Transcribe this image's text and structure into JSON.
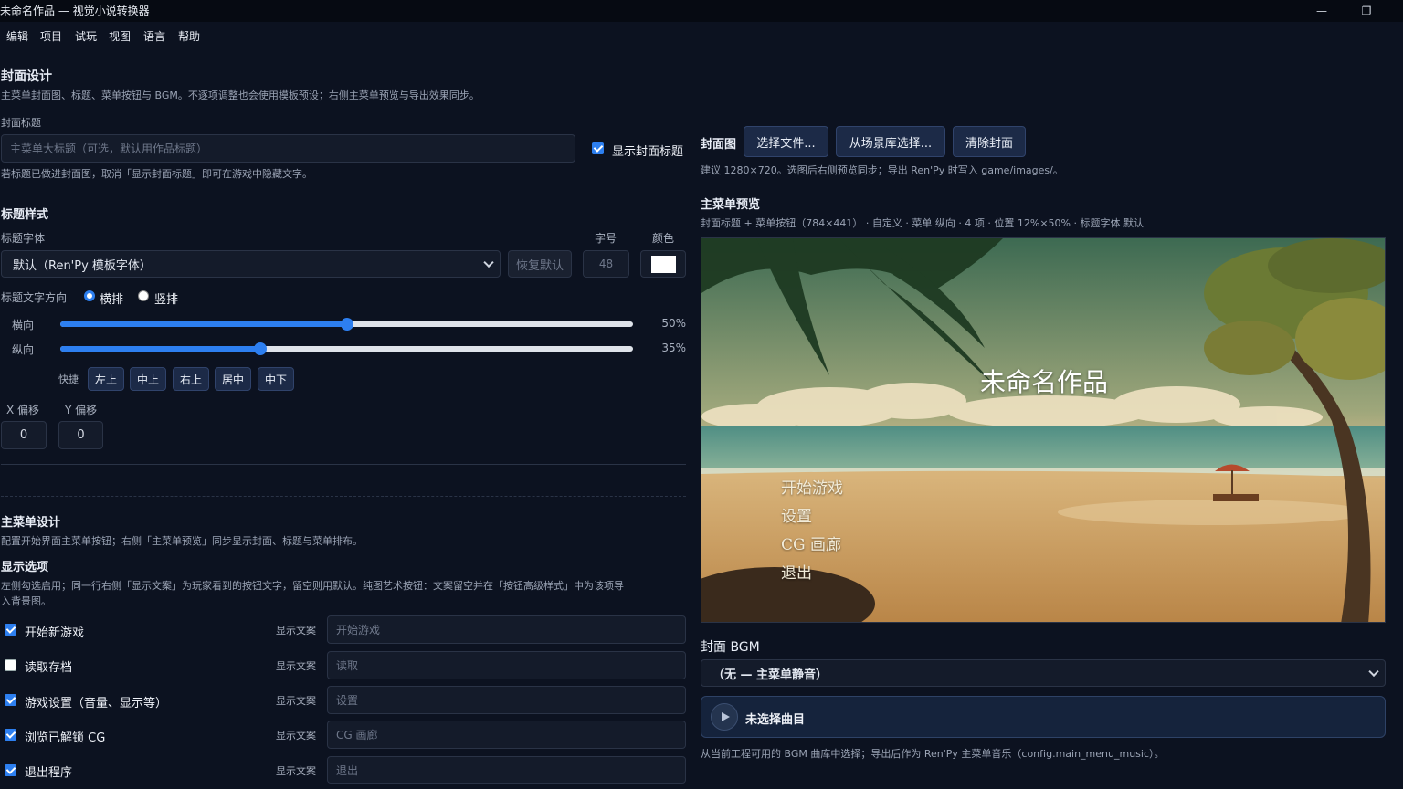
{
  "window": {
    "title": "未命名作品 — 视觉小说转换器",
    "minimize": "—",
    "restore": "❐"
  },
  "menu": [
    "编辑",
    "项目",
    "试玩",
    "视图",
    "语言",
    "帮助"
  ],
  "cover": {
    "heading": "封面设计",
    "desc": "主菜单封面图、标题、菜单按钮与 BGM。不逐项调整也会使用模板预设；右侧主菜单预览与导出效果同步。",
    "title_label": "封面标题",
    "title_placeholder": "主菜单大标题（可选，默认用作品标题）",
    "show_title_label": "显示封面标题",
    "show_title_checked": true,
    "title_hint": "若标题已做进封面图，取消「显示封面标题」即可在游戏中隐藏文字。"
  },
  "title_style": {
    "heading": "标题样式",
    "font_label": "标题字体",
    "font_value": "默认（Ren'Py 模板字体）",
    "reset_button": "恢复默认",
    "size_label": "字号",
    "size_value": "48",
    "color_label": "颜色",
    "color_value": "#ffffff",
    "direction_label": "标题文字方向",
    "direction_horizontal": "横排",
    "direction_vertical": "竖排",
    "direction_selected": "horizontal",
    "h_label": "横向",
    "h_value": 50,
    "h_text": "50%",
    "v_label": "纵向",
    "v_value": 35,
    "v_text": "35%",
    "quick_label": "快捷",
    "quick_buttons": [
      "左上",
      "中上",
      "右上",
      "居中",
      "中下"
    ],
    "x_offset_label": "X 偏移",
    "x_offset_value": "0",
    "y_offset_label": "Y 偏移",
    "y_offset_value": "0"
  },
  "main_menu": {
    "heading": "主菜单设计",
    "desc": "配置开始界面主菜单按钮；右侧「主菜单预览」同步显示封面、标题与菜单排布。",
    "options_heading": "显示选项",
    "options_desc_1": "左侧勾选启用；同一行右侧「显示文案」为玩家看到的按钮文字，留空则用默认。纯图艺术按钮：文案留空并在「按钮高级样式」中为该项导",
    "options_desc_2": "入背景图。",
    "display_text_label": "显示文案",
    "items": [
      {
        "label": "开始新游戏",
        "checked": true,
        "placeholder": "开始游戏"
      },
      {
        "label": "读取存档",
        "checked": false,
        "placeholder": "读取"
      },
      {
        "label": "游戏设置（音量、显示等）",
        "checked": true,
        "placeholder": "设置"
      },
      {
        "label": "浏览已解锁 CG",
        "checked": true,
        "placeholder": "CG 画廊"
      },
      {
        "label": "退出程序",
        "checked": true,
        "placeholder": "退出"
      }
    ]
  },
  "cover_image": {
    "label": "封面图",
    "choose_file": "选择文件...",
    "from_library": "从场景库选择...",
    "clear": "清除封面",
    "hint": "建议 1280×720。选图后右侧预览同步；导出 Ren'Py 时写入 game/images/。"
  },
  "preview": {
    "heading": "主菜单预览",
    "meta": "封面标题 + 菜单按钮（784×441） · 自定义 · 菜单 纵向 · 4 项 · 位置 12%×50% · 标题字体 默认",
    "title": "未命名作品",
    "menu": [
      "开始游戏",
      "设置",
      "CG 画廊",
      "退出"
    ]
  },
  "bgm": {
    "heading": "封面 BGM",
    "select_value": "（无 — 主菜单静音）",
    "track": "未选择曲目",
    "hint": "从当前工程可用的 BGM 曲库中选择；导出后作为 Ren'Py 主菜单音乐（config.main_menu_music）。"
  }
}
